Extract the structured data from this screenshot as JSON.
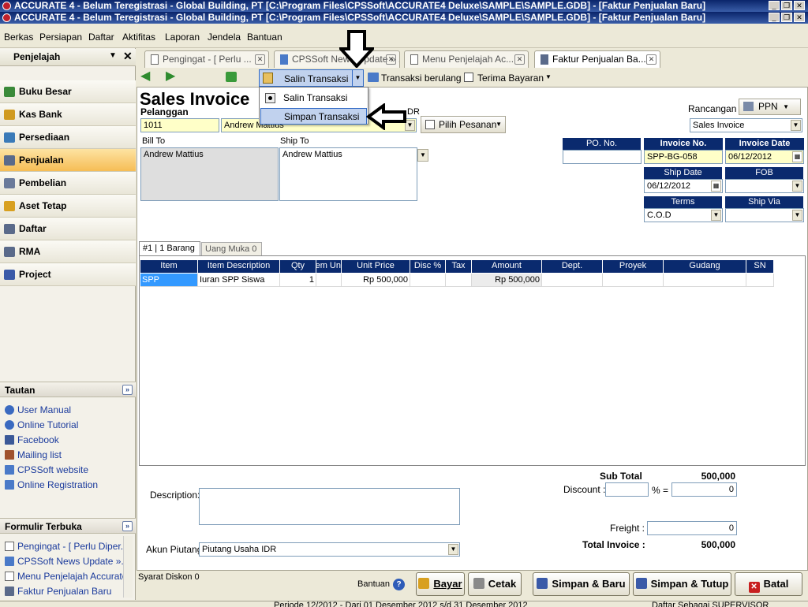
{
  "window": {
    "title_line1": "ACCURATE 4  - Belum Teregistrasi - Global Building, PT   [C:\\Program Files\\CPSSoft\\ACCURATE4 Deluxe\\SAMPLE\\SAMPLE.GDB] - [Faktur Penjualan Baru]",
    "title_line2": "ACCURATE 4  - Belum Teregistrasi - Global Building, PT   [C:\\Program Files\\CPSSoft\\ACCURATE4 Deluxe\\SAMPLE\\SAMPLE.GDB] - [Faktur Penjualan Baru]"
  },
  "menubar": [
    "Berkas",
    "Persiapan",
    "Daftar",
    "Aktifitas",
    "Laporan",
    "Jendela",
    "Bantuan"
  ],
  "explorer": {
    "title": "Penjelajah",
    "items": [
      {
        "label": "Buku Besar",
        "color": "#3a8a3a"
      },
      {
        "label": "Kas Bank",
        "color": "#d09a20"
      },
      {
        "label": "Persediaan",
        "color": "#3a7ab8"
      },
      {
        "label": "Penjualan",
        "color": "#5a6a8a"
      },
      {
        "label": "Pembelian",
        "color": "#6a7a9a"
      },
      {
        "label": "Aset Tetap",
        "color": "#d8a020"
      },
      {
        "label": "Daftar",
        "color": "#5a6a8a"
      },
      {
        "label": "RMA",
        "color": "#5a6a8a"
      },
      {
        "label": "Project",
        "color": "#3a5aa8"
      }
    ],
    "active_index": 3
  },
  "tautan": {
    "title": "Tautan",
    "links": [
      "User Manual",
      "Online Tutorial",
      "Facebook",
      "Mailing list",
      "CPSSoft website",
      "Online Registration"
    ]
  },
  "formulir": {
    "title": "Formulir Terbuka",
    "items": [
      "Pengingat - [ Perlu Diper...",
      "CPSSoft News Update »...",
      "Menu Penjelajah Accurate",
      "Faktur Penjualan Baru"
    ]
  },
  "tabs": [
    {
      "label": "Pengingat - [ Perlu ..."
    },
    {
      "label": "CPSSoft News Update » ..."
    },
    {
      "label": "Menu Penjelajah Ac..."
    },
    {
      "label": "Faktur Penjualan Ba..."
    }
  ],
  "toolbar": {
    "salin": "Salin Transaksi",
    "berulang": "Transaksi berulang",
    "terima": "Terima Bayaran"
  },
  "dropdown_menu": {
    "items": [
      "Salin Transaksi",
      "Simpan Transaksi"
    ]
  },
  "form": {
    "title": "Sales Invoice",
    "pelanggan_label": "Pelanggan",
    "customer_id": "1011",
    "customer_name": "Andrew Mattius",
    "currency": "DR",
    "pilih_pesanan": "Pilih Pesanan",
    "rancangan_label": "Rancangan",
    "ppn": "PPN",
    "rancangan_value": "Sales Invoice",
    "bill_to_label": "Bill To",
    "bill_to": "Andrew Mattius",
    "ship_to_label": "Ship To",
    "ship_to": "Andrew Mattius",
    "po_no_label": "PO. No.",
    "po_no": "",
    "invoice_no_label": "Invoice No.",
    "invoice_no": "SPP-BG-058",
    "invoice_date_label": "Invoice Date",
    "invoice_date": "06/12/2012",
    "ship_date_label": "Ship Date",
    "ship_date": "06/12/2012",
    "fob_label": "FOB",
    "fob": "",
    "terms_label": "Terms",
    "terms": "C.O.D",
    "ship_via_label": "Ship Via",
    "ship_via": ""
  },
  "subtabs": [
    "#1 | 1 Barang",
    "Uang Muka   0"
  ],
  "grid": {
    "columns": [
      "Item",
      "Item Description",
      "Qty",
      "Item Un",
      "Unit Price",
      "Disc %",
      "Tax",
      "Amount",
      "Dept.",
      "Proyek",
      "Gudang",
      "SN"
    ],
    "rows": [
      [
        "SPP",
        "Iuran SPP Siswa",
        "1",
        "",
        "Rp 500,000",
        "",
        "",
        "Rp 500,000",
        "",
        "",
        "",
        ""
      ]
    ]
  },
  "totals": {
    "subtotal_label": "Sub Total",
    "subtotal": "500,000",
    "discount_label": "Discount :",
    "discount_pct": "",
    "pct_eq": "% =",
    "discount_amount": "0",
    "freight_label": "Freight :",
    "freight": "0",
    "total_label": "Total Invoice :",
    "total": "500,000"
  },
  "footer": {
    "description_label": "Description:",
    "description": "",
    "akun_label": "Akun Piutang",
    "akun": "Piutang Usaha IDR",
    "syarat": "Syarat Diskon 0",
    "bantuan": "Bantuan",
    "buttons": {
      "bayar": "Bayar",
      "cetak": "Cetak",
      "simpan_baru": "Simpan & Baru",
      "simpan_tutup": "Simpan & Tutup",
      "batal": "Batal"
    }
  },
  "status": {
    "periode": "Periode 12/2012 - Dari 01 Desember 2012 s/d 31 Desember 2012",
    "user": "Daftar Sebagai SUPERVISOR"
  }
}
